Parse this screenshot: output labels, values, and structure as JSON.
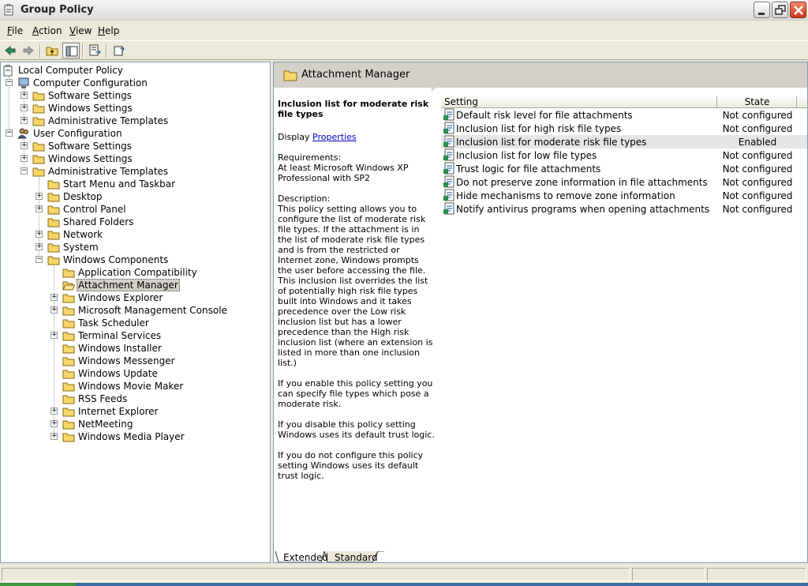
{
  "window": {
    "title": "Group Policy"
  },
  "menu": [
    {
      "label": "File",
      "accel": "F",
      "rest": "ile"
    },
    {
      "label": "Action",
      "accel": "A",
      "rest": "ction"
    },
    {
      "label": "View",
      "accel": "V",
      "rest": "iew"
    },
    {
      "label": "Help",
      "accel": "H",
      "rest": "elp"
    }
  ],
  "toolbar": [
    "back-icon",
    "forward-icon",
    "up-folder-icon",
    "show-hide-tree-icon",
    "export-list-icon",
    "help-icon"
  ],
  "tree": {
    "root": "Local Computer Policy",
    "computer_config": "Computer Configuration",
    "cc_software": "Software Settings",
    "cc_windows": "Windows Settings",
    "cc_admin": "Administrative Templates",
    "user_config": "User Configuration",
    "uc_software": "Software Settings",
    "uc_windows": "Windows Settings",
    "uc_admin": "Administrative Templates",
    "start_menu": "Start Menu and Taskbar",
    "desktop": "Desktop",
    "control_panel": "Control Panel",
    "shared_folders": "Shared Folders",
    "network": "Network",
    "system": "System",
    "windows_components": "Windows Components",
    "app_compat": "Application Compatibility",
    "attachment_manager": "Attachment Manager",
    "windows_explorer": "Windows Explorer",
    "mmc": "Microsoft Management Console",
    "task_scheduler": "Task Scheduler",
    "terminal_services": "Terminal Services",
    "windows_installer": "Windows Installer",
    "windows_messenger": "Windows Messenger",
    "windows_update": "Windows Update",
    "movie_maker": "Windows Movie Maker",
    "rss_feeds": "RSS Feeds",
    "internet_explorer": "Internet Explorer",
    "netmeeting": "NetMeeting",
    "media_player": "Windows Media Player"
  },
  "content": {
    "header_title": "Attachment Manager",
    "desc_title": "Inclusion list for moderate risk file types",
    "display_prefix": "Display ",
    "display_link": "Properties",
    "requirements": "Requirements:\nAt least Microsoft Windows XP Professional with SP2",
    "description": "Description:\nThis policy setting allows you to configure the list of moderate risk file types. If the attachment is in the list of moderate risk file types and is from the restricted or Internet zone, Windows prompts the user before accessing the file. This inclusion list overrides the list of potentially high risk file types built into Windows and it takes precedence over the Low risk inclusion list but has a lower precedence than the High risk inclusion list (where an extension is listed in more than one inclusion list.)",
    "enable_text": "If you enable this policy setting you can specify file types which pose a moderate risk.",
    "disable_text": "If you disable this policy setting Windows uses its default trust logic.",
    "notconfig_text": "If you do not configure this policy setting Windows uses its default trust logic."
  },
  "list": {
    "col_setting": "Setting",
    "col_state": "State",
    "rows": [
      {
        "name": "Default risk level for file attachments",
        "state": "Not configured"
      },
      {
        "name": "Inclusion list for high risk file types",
        "state": "Not configured"
      },
      {
        "name": "Inclusion list for moderate risk file types",
        "state": "Enabled"
      },
      {
        "name": "Inclusion list for low file types",
        "state": "Not configured"
      },
      {
        "name": "Trust logic for file attachments",
        "state": "Not configured"
      },
      {
        "name": "Do not preserve zone information in file attachments",
        "state": "Not configured"
      },
      {
        "name": "Hide mechanisms to remove zone information",
        "state": "Not configured"
      },
      {
        "name": "Notify antivirus programs when opening attachments",
        "state": "Not configured"
      }
    ]
  },
  "tabs": {
    "extended": "Extended",
    "standard": "Standard"
  }
}
